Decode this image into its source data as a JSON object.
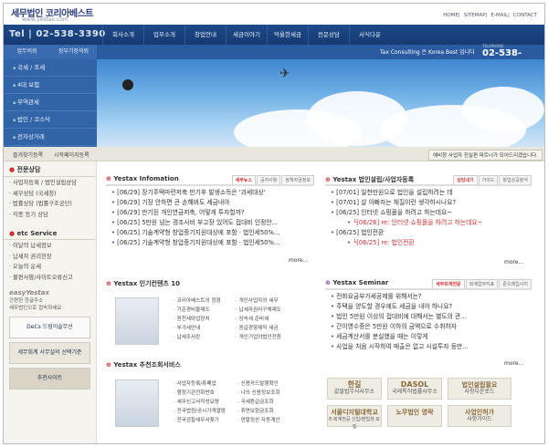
{
  "header": {
    "logo": "세무법인 코리아베스트",
    "logo_url": "www.yestax.com",
    "util": [
      "HOME",
      "SITEMAP",
      "E-MAIL",
      "CONTACT"
    ],
    "phone": "Tel | 02-538-3390",
    "menu": [
      "회사소개",
      "업무소개",
      "창업안내",
      "세금이야기",
      "억울한세금",
      "전문상담",
      "서식다운"
    ],
    "side_tabs": [
      "업무의뢰",
      "장부기장의뢰"
    ],
    "tagline": "Tax Consulting 은 Korea Best 입니다",
    "phone2_label": "TELEPHONE",
    "phone2": "02-538-3390"
  },
  "left_menu": [
    "국세 / 조세",
    "4대 보험",
    "무역관세",
    "법인 / 코스닥",
    "전자상거래"
  ],
  "quick": {
    "items": [
      "즐겨찾기등록",
      "시작페이지등록"
    ],
    "notice": "예비창 사업자 진실편 파트너가 되어드리겠습니다."
  },
  "sidebar": {
    "consult_title": "전문상담",
    "consult": [
      "사업자등록 / 법인설립상담",
      "세무상담 (국세청)",
      "법률상담 (법률구조공단)",
      "각종 등기 상담"
    ],
    "etc_title": "etc Service",
    "etc": [
      "이달의 납세정보",
      "납세자 권리헌장",
      "오늘의 운세",
      "불편사항/사이트오류신고"
    ],
    "brand": "easyYestax",
    "brand_sub1": "간편한 한글주소",
    "brand_sub2": "세무법인으로 접속하세요",
    "promo": [
      "DeCs 드림이슬무선",
      "세무회계 사무실의 선택기준",
      "추천사이트"
    ]
  },
  "info": {
    "title": "Yestax Infomation",
    "tabs": [
      "세무뉴스",
      "공지사항",
      "정책자금정보"
    ],
    "items": [
      "[06/29] 장기주택마련저축 만기후 발생소득은 '과세대상'",
      "[06/29] 기장 안하면 큰 손해봐도 세금내야",
      "[06/29] 만기된 개인연금저축, 어떻게 투자할까?",
      "[06/25] 5만원 넘는 경조사비 부고장 있어도 접대비 인정안...",
      "[06/25] 기술계약형 창업중기지원대상에 포함 · 법인세50%...",
      "[06/25] 기술계약형 창업중기지원대상에 포함 · 법인세50%..."
    ],
    "more": "more..."
  },
  "qna": {
    "title": "Yestax 법인설립/사업자등록",
    "tabs": [
      "상담내기",
      "가이드",
      "창업상공분석"
    ],
    "items": [
      "[07/01] 일천만원으로 법인을 설립하려는 데",
      "[07/01] 살 아빠자는 체질이란 생각하시나요?",
      "[06/25] 인터넷 쇼핑몰을 하려고 하는데요~",
      "└[06/26] re: 인터넷 쇼핑몰을 하려고 하는데요~",
      "[06/25] 법인전환",
      "└[06/25] re: 법인전환"
    ],
    "more": "more..."
  },
  "contents": {
    "title": "Yestax 인기컨텐츠 10",
    "col1": [
      "코리아베스트의 정점",
      "기준경비율제도",
      "원천세와업장치",
      "부가세안내",
      "납세조사란"
    ],
    "col2": [
      "개인사업자의 세무",
      "납세자권리구체제도",
      "상속세 준비세",
      "동급경향제작 세금",
      "개인기업의법인전환"
    ]
  },
  "seminar": {
    "title": "Yestax Seminar",
    "tabs": [
      "세무회계전문",
      "회계업무지표",
      "준으레입사지"
    ],
    "items": [
      "전화요금부가세공제를 위해서는?",
      "주택을 양도할 경우에도 세금을 내야 하나요?",
      "법인 5만원 이상의 접대비에 대해서는 별도의 관...",
      "간이영수증은 5만원 이하의 금액으로 수취하자",
      "세금계산서를 분실했을 때는 이렇게",
      "사업을 처음 시작하여 매출은 없고 시설투자 등만..."
    ],
    "more": "more..."
  },
  "service": {
    "title": "Yestax 추천조회서비스",
    "col1": [
      "사업자등록/휴폐업",
      "행정기관전화번호",
      "세무신고서작성요령",
      "전국법원/공시가격열람",
      "전국검찰세무서찾기"
    ],
    "col2": [
      "신용카드발행확인",
      "나의 신용정보조회",
      "국세환급금조회",
      "휴면보험금조회",
      "연말정산 자동계산"
    ]
  },
  "bottom_buttons": [
    {
      "t": "한길",
      "s": "값쌀법무사사무소"
    },
    {
      "t": "DASOL",
      "s": "국제특허법률사무소"
    },
    {
      "t": "법인설립필요",
      "s": "사항다운로드"
    },
    {
      "t": "서울디지털대학교",
      "s": "E-회계전공 신입/편입생 모집"
    },
    {
      "t": "노무법인 영락",
      "s": ""
    },
    {
      "t": "사업인허가",
      "s": "사항가이드"
    }
  ]
}
